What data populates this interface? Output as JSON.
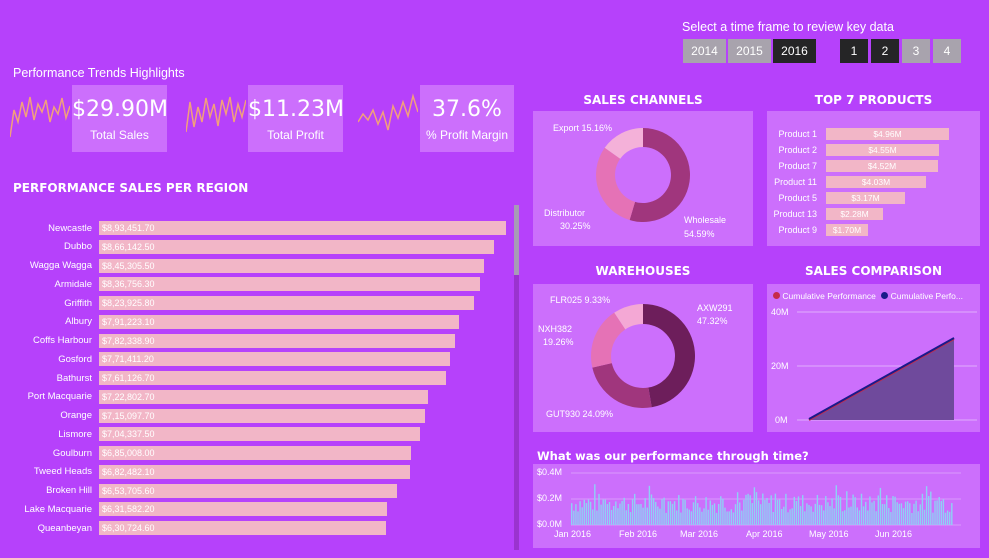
{
  "time_frame": {
    "label": "Select a time frame to review key data",
    "years": [
      "2014",
      "2015",
      "2016"
    ],
    "selected_year": "2016",
    "quarters": [
      "1",
      "2",
      "3",
      "4"
    ],
    "selected_quarters": [
      "1",
      "2"
    ]
  },
  "highlights": {
    "title": "Performance Trends Highlights",
    "kpis": [
      {
        "value": "$29.90M",
        "caption": "Total Sales"
      },
      {
        "value": "$11.23M",
        "caption": "Total Profit"
      },
      {
        "value": "37.6%",
        "caption": "% Profit Margin"
      }
    ]
  },
  "colors": {
    "background": "#b641fb",
    "panel": "#cc6ffc",
    "bar": "#f2b6c7",
    "wholesale": "#a0367d",
    "distributor": "#e572b6",
    "export": "#f4b1d9",
    "axw": "#6d1e5b",
    "gut": "#a0367d",
    "nxh": "#e572b6",
    "flr": "#f4a8d5",
    "cum1": "#c62a4a",
    "cum2": "#1a1a8a",
    "area": "#6f4a9c",
    "spark": "#f2a07b",
    "timeline": "#8fd0f5"
  },
  "region_chart": {
    "title": "PERFORMANCE SALES PER REGION",
    "rows": [
      {
        "region": "Newcastle",
        "label": "$8,93,451.70",
        "value": 893451.7
      },
      {
        "region": "Dubbo",
        "label": "$8,66,142.50",
        "value": 866142.5
      },
      {
        "region": "Wagga Wagga",
        "label": "$8,45,305.50",
        "value": 845305.5
      },
      {
        "region": "Armidale",
        "label": "$8,36,756.30",
        "value": 836756.3
      },
      {
        "region": "Griffith",
        "label": "$8,23,925.80",
        "value": 823925.8
      },
      {
        "region": "Albury",
        "label": "$7,91,223.10",
        "value": 791223.1
      },
      {
        "region": "Coffs Harbour",
        "label": "$7,82,338.90",
        "value": 782338.9
      },
      {
        "region": "Gosford",
        "label": "$7,71,411.20",
        "value": 771411.2
      },
      {
        "region": "Bathurst",
        "label": "$7,61,126.70",
        "value": 761126.7
      },
      {
        "region": "Port Macquarie",
        "label": "$7,22,802.70",
        "value": 722802.7
      },
      {
        "region": "Orange",
        "label": "$7,15,097.70",
        "value": 715097.7
      },
      {
        "region": "Lismore",
        "label": "$7,04,337.50",
        "value": 704337.5
      },
      {
        "region": "Goulburn",
        "label": "$6,85,008.00",
        "value": 685008.0
      },
      {
        "region": "Tweed Heads",
        "label": "$6,82,482.10",
        "value": 682482.1
      },
      {
        "region": "Broken Hill",
        "label": "$6,53,705.60",
        "value": 653705.6
      },
      {
        "region": "Lake Macquarie",
        "label": "$6,31,582.20",
        "value": 631582.2
      },
      {
        "region": "Queanbeyan",
        "label": "$6,30,724.60",
        "value": 630724.6
      }
    ]
  },
  "sales_channels": {
    "title": "SALES CHANNELS",
    "slices": [
      {
        "name": "Wholesale",
        "value": 54.59,
        "label_name": "Wholesale",
        "label_pct": "54.59%"
      },
      {
        "name": "Distributor",
        "value": 30.25,
        "label_name": "Distributor",
        "label_pct": "30.25%"
      },
      {
        "name": "Export",
        "value": 15.16,
        "label_name": "Export",
        "label_pct": "15.16%"
      }
    ]
  },
  "top_products": {
    "title": "TOP 7 PRODUCTS",
    "rows": [
      {
        "name": "Product 1",
        "label": "$4.96M",
        "value": 4.96
      },
      {
        "name": "Product 2",
        "label": "$4.55M",
        "value": 4.55
      },
      {
        "name": "Product 7",
        "label": "$4.52M",
        "value": 4.52
      },
      {
        "name": "Product 11",
        "label": "$4.03M",
        "value": 4.03
      },
      {
        "name": "Product 5",
        "label": "$3.17M",
        "value": 3.17
      },
      {
        "name": "Product 13",
        "label": "$2.28M",
        "value": 2.28
      },
      {
        "name": "Product 9",
        "label": "$1.70M",
        "value": 1.7
      }
    ]
  },
  "warehouses": {
    "title": "WAREHOUSES",
    "slices": [
      {
        "name": "AXW291",
        "value": 47.32,
        "label_name": "AXW291",
        "label_pct": "47.32%"
      },
      {
        "name": "GUT930",
        "value": 24.09,
        "label_name": "GUT930",
        "label_pct": "24.09%"
      },
      {
        "name": "NXH382",
        "value": 19.26,
        "label_name": "NXH382",
        "label_pct": "19.26%"
      },
      {
        "name": "FLR025",
        "value": 9.33,
        "label_name": "FLR025",
        "label_pct": "9.33%"
      }
    ]
  },
  "sales_comparison": {
    "title": "SALES COMPARISON",
    "legend": [
      "Cumulative Performance",
      "Cumulative Perfo..."
    ],
    "y_ticks": [
      "40M",
      "20M",
      "0M"
    ]
  },
  "timeline": {
    "title": "What was our performance through time?",
    "y_ticks": [
      "$0.4M",
      "$0.2M",
      "$0.0M"
    ],
    "x_ticks": [
      "Jan 2016",
      "Feb 2016",
      "Mar 2016",
      "Apr 2016",
      "May 2016",
      "Jun 2016"
    ]
  },
  "chart_data": [
    {
      "type": "bar",
      "title": "PERFORMANCE SALES PER REGION",
      "categories": [
        "Newcastle",
        "Dubbo",
        "Wagga Wagga",
        "Armidale",
        "Griffith",
        "Albury",
        "Coffs Harbour",
        "Gosford",
        "Bathurst",
        "Port Macquarie",
        "Orange",
        "Lismore",
        "Goulburn",
        "Tweed Heads",
        "Broken Hill",
        "Lake Macquarie",
        "Queanbeyan"
      ],
      "values": [
        893451.7,
        866142.5,
        845305.5,
        836756.3,
        823925.8,
        791223.1,
        782338.9,
        771411.2,
        761126.7,
        722802.7,
        715097.7,
        704337.5,
        685008.0,
        682482.1,
        653705.6,
        631582.2,
        630724.6
      ]
    },
    {
      "type": "pie",
      "title": "SALES CHANNELS",
      "categories": [
        "Wholesale",
        "Distributor",
        "Export"
      ],
      "values": [
        54.59,
        30.25,
        15.16
      ]
    },
    {
      "type": "bar",
      "title": "TOP 7 PRODUCTS",
      "categories": [
        "Product 1",
        "Product 2",
        "Product 7",
        "Product 11",
        "Product 5",
        "Product 13",
        "Product 9"
      ],
      "values": [
        4.96,
        4.55,
        4.52,
        4.03,
        3.17,
        2.28,
        1.7
      ]
    },
    {
      "type": "pie",
      "title": "WAREHOUSES",
      "categories": [
        "AXW291",
        "GUT930",
        "NXH382",
        "FLR025"
      ],
      "values": [
        47.32,
        24.09,
        19.26,
        9.33
      ]
    },
    {
      "type": "area",
      "title": "SALES COMPARISON",
      "series": [
        {
          "name": "Cumulative Performance",
          "values": [
            0,
            30
          ]
        },
        {
          "name": "Cumulative Perfo...",
          "values": [
            0,
            30
          ]
        }
      ],
      "ylim": [
        0,
        40
      ]
    }
  ]
}
